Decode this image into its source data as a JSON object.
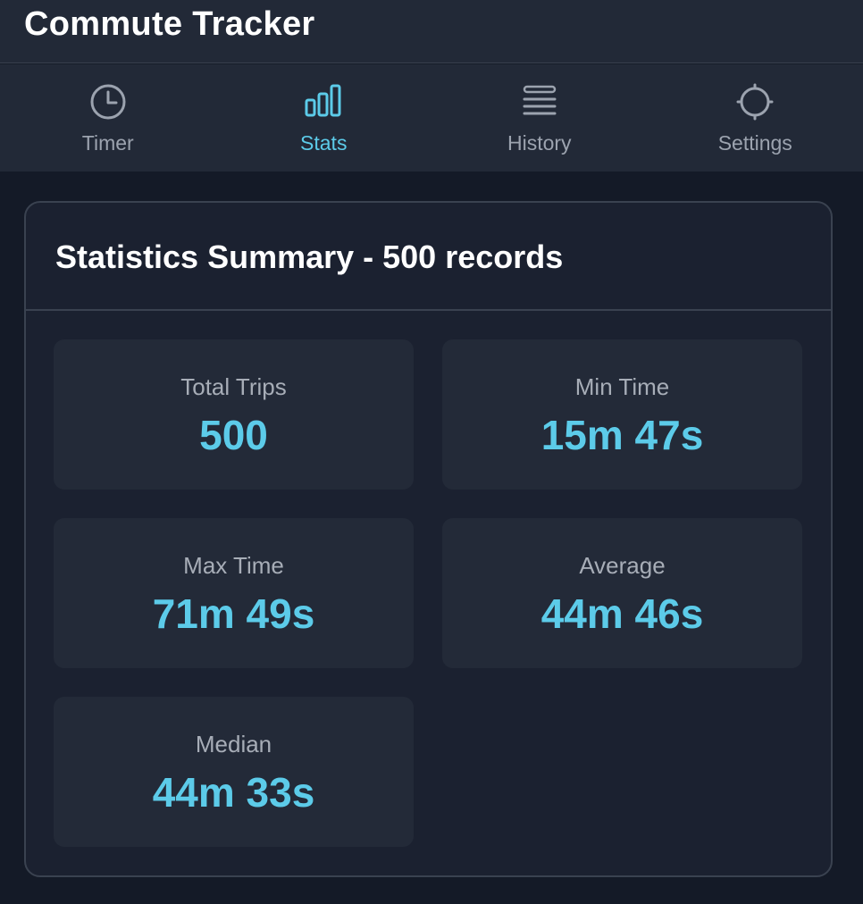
{
  "app": {
    "title": "Commute Tracker"
  },
  "tabs": [
    {
      "label": "Timer",
      "icon": "clock-icon",
      "active": false
    },
    {
      "label": "Stats",
      "icon": "bar-chart-icon",
      "active": true
    },
    {
      "label": "History",
      "icon": "list-icon",
      "active": false
    },
    {
      "label": "Settings",
      "icon": "gear-icon",
      "active": false
    }
  ],
  "summary": {
    "title": "Statistics Summary - 500 records",
    "stats": [
      {
        "label": "Total Trips",
        "value": "500"
      },
      {
        "label": "Min Time",
        "value": "15m 47s"
      },
      {
        "label": "Max Time",
        "value": "71m 49s"
      },
      {
        "label": "Average",
        "value": "44m 46s"
      },
      {
        "label": "Median",
        "value": "44m 33s"
      }
    ]
  },
  "colors": {
    "accent": "#5ccbe9",
    "background": "#141a27",
    "panel": "#222937",
    "card": "#1b2130",
    "tile": "#232a38",
    "muted_text": "#9ca3af"
  }
}
